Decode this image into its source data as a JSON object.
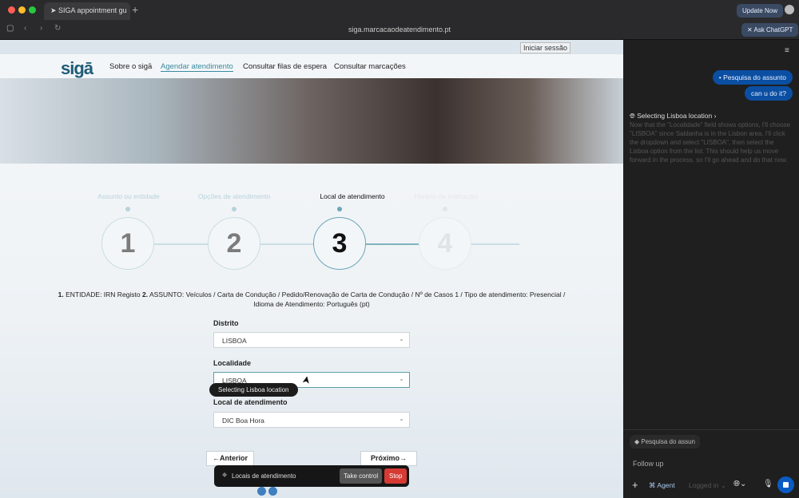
{
  "browser": {
    "tab_title": "SIGA appointment gu",
    "url": "siga.marcacaodeatendimento.pt",
    "update_label": "Update Now",
    "ask_label": "Ask ChatGPT"
  },
  "site": {
    "logo": "sigā",
    "login": "Iniciar sessão",
    "nav": [
      "Sobre o sigā",
      "Agendar atendimento",
      "Consultar filas de espera",
      "Consultar marcações"
    ]
  },
  "steps": [
    {
      "label": "Assunto ou entidade",
      "num": "1"
    },
    {
      "label": "Opções de atendimento",
      "num": "2"
    },
    {
      "label": "Local de atendimento",
      "num": "3"
    },
    {
      "label": "Horário da marcação",
      "num": "4"
    }
  ],
  "summary": {
    "p1": "1.",
    "t1": " ENTIDADE: IRN Registo ",
    "p2": "2.",
    "t2": " ASSUNTO: Veículos / Carta de Condução / Pedido/Renovação de Carta de Condução / Nº de Casos 1 / Tipo de atendimento: Presencial / Idioma de Atendimento: Português (pt)"
  },
  "form": {
    "distrito_label": "Distrito",
    "distrito": "LISBOA",
    "localidade_label": "Localidade",
    "localidade": "LISBOA",
    "local_label": "Local de atendimento",
    "local": "DIC Boa Hora"
  },
  "buttons": {
    "prev": "←Anterior",
    "next": "Próximo→"
  },
  "agent": {
    "tooltip": "Selecting Lisboa location",
    "status": "Locais de atendimento",
    "take_control": "Take control",
    "stop": "Stop"
  },
  "sidebar": {
    "msg1": "Pesquisa do assunto",
    "msg2": "can u do it?",
    "reason_title": "Selecting Lisboa location",
    "reason_text": "Now that the \"Localidade\" field shows options, I'll choose \"LISBOA\" since Saldanha is in the Lisbon area. I'll click the dropdown and select \"LISBOA\", then select the Lisboa option from the list. This should help us move forward in the process, so I'll go ahead and do that now.",
    "chip": "Pesquisa do assun",
    "followup": "Follow up",
    "agent": "Agent",
    "logged": "Logged in"
  }
}
